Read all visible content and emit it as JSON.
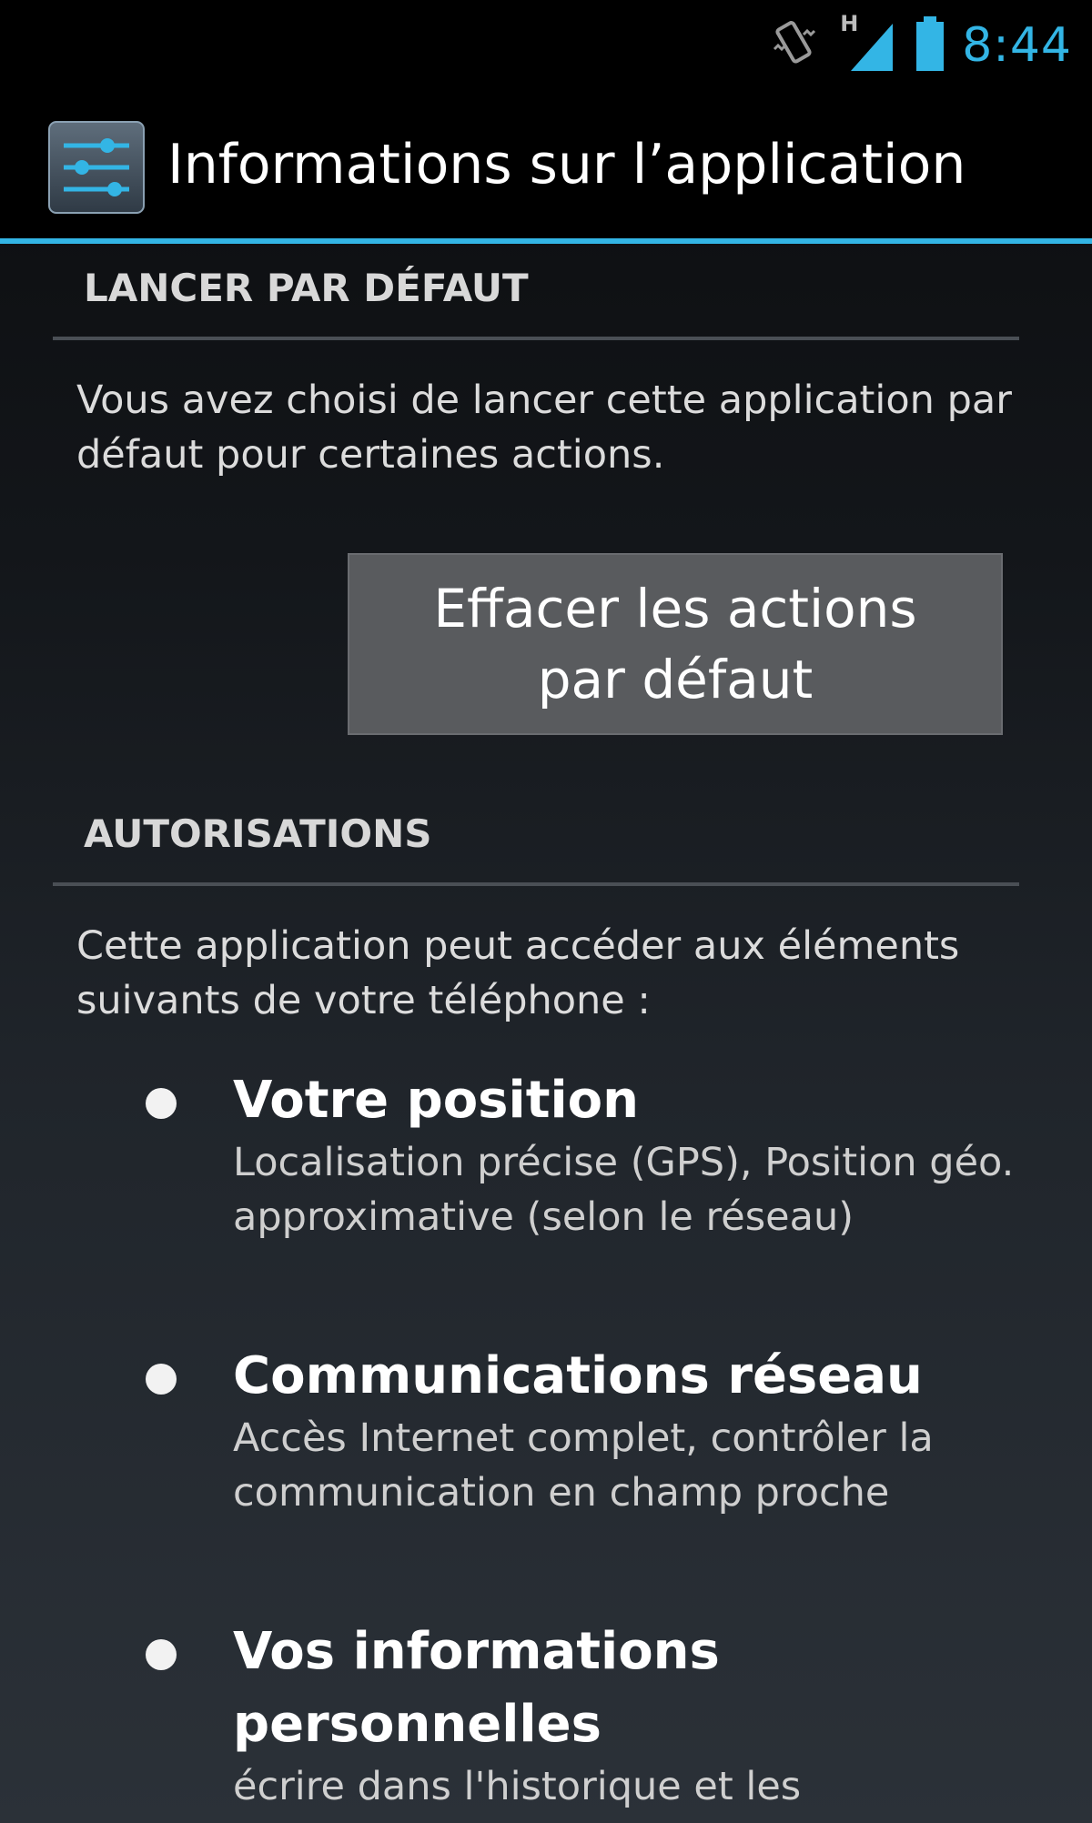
{
  "status_bar": {
    "time": "8:44",
    "network_label": "H",
    "icons": [
      "vibrate-icon",
      "signal-icon",
      "battery-icon"
    ],
    "accent_color": "#33b5e5"
  },
  "action_bar": {
    "title": "Informations sur l’application",
    "icon": "settings-sliders-icon"
  },
  "launch_default": {
    "header": "LANCER PAR DÉFAUT",
    "text": "Vous avez choisi de lancer cette application par défaut pour certaines actions.",
    "button_label": "Effacer les actions par défaut"
  },
  "permissions": {
    "header": "AUTORISATIONS",
    "intro": "Cette application peut accéder aux éléments suivants de votre téléphone :",
    "items": [
      {
        "title": "Votre position",
        "description": "Localisation précise (GPS), Position géo. approximative (selon le réseau)"
      },
      {
        "title": "Communications réseau",
        "description": "Accès Internet complet, contrôler la communication en champ proche"
      },
      {
        "title": "Vos informations personnelles",
        "description": "écrire dans l'historique et les"
      }
    ]
  }
}
